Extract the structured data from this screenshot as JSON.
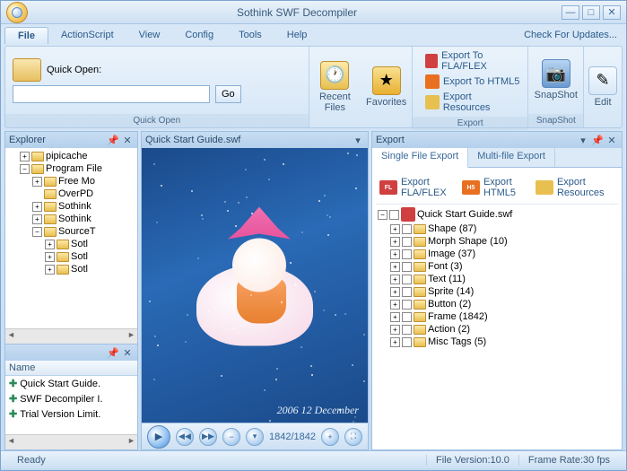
{
  "app": {
    "title": "Sothink SWF Decompiler"
  },
  "menu": {
    "file": "File",
    "actionscript": "ActionScript",
    "view": "View",
    "config": "Config",
    "tools": "Tools",
    "help": "Help",
    "updates": "Check For Updates..."
  },
  "ribbon": {
    "quickopen_label": "Quick Open:",
    "go": "Go",
    "recent": "Recent Files",
    "favorites": "Favorites",
    "exp_fla": "Export To FLA/FLEX",
    "exp_html5": "Export To HTML5",
    "exp_res": "Export Resources",
    "snapshot": "SnapShot",
    "edit": "Edit",
    "group_quickopen": "Quick Open",
    "group_export": "Export",
    "group_snapshot": "SnapShot"
  },
  "panels": {
    "explorer": "Explorer",
    "export": "Export",
    "preview_file": "Quick Start Guide.swf"
  },
  "explorer_tree": [
    {
      "indent": 1,
      "exp": "+",
      "label": "pipicache"
    },
    {
      "indent": 1,
      "exp": "−",
      "label": "Program File"
    },
    {
      "indent": 2,
      "exp": "+",
      "label": "Free Mo"
    },
    {
      "indent": 2,
      "exp": "",
      "label": "OverPD"
    },
    {
      "indent": 2,
      "exp": "+",
      "label": "Sothink"
    },
    {
      "indent": 2,
      "exp": "+",
      "label": "Sothink"
    },
    {
      "indent": 2,
      "exp": "−",
      "label": "SourceT"
    },
    {
      "indent": 3,
      "exp": "+",
      "label": "Sotl"
    },
    {
      "indent": 3,
      "exp": "+",
      "label": "Sotl"
    },
    {
      "indent": 3,
      "exp": "+",
      "label": "Sotl"
    }
  ],
  "name_col": "Name",
  "file_list": [
    "Quick Start Guide.",
    "SWF Decompiler I.",
    "Trial Version Limit."
  ],
  "preview": {
    "date": "2006 12 December",
    "frame": "1842/1842"
  },
  "export_tabs": {
    "single": "Single File Export",
    "multi": "Multi-file Export"
  },
  "export_buttons": {
    "fla": "Export FLA/FLEX",
    "html5": "Export HTML5",
    "res": "Export Resources"
  },
  "export_tree": {
    "root": "Quick Start Guide.swf",
    "items": [
      "Shape (87)",
      "Morph Shape (10)",
      "Image (37)",
      "Font (3)",
      "Text (11)",
      "Sprite (14)",
      "Button (2)",
      "Frame (1842)",
      "Action (2)",
      "Misc Tags (5)"
    ]
  },
  "status": {
    "ready": "Ready",
    "version": "File Version:10.0",
    "framerate": "Frame Rate:30 fps"
  }
}
